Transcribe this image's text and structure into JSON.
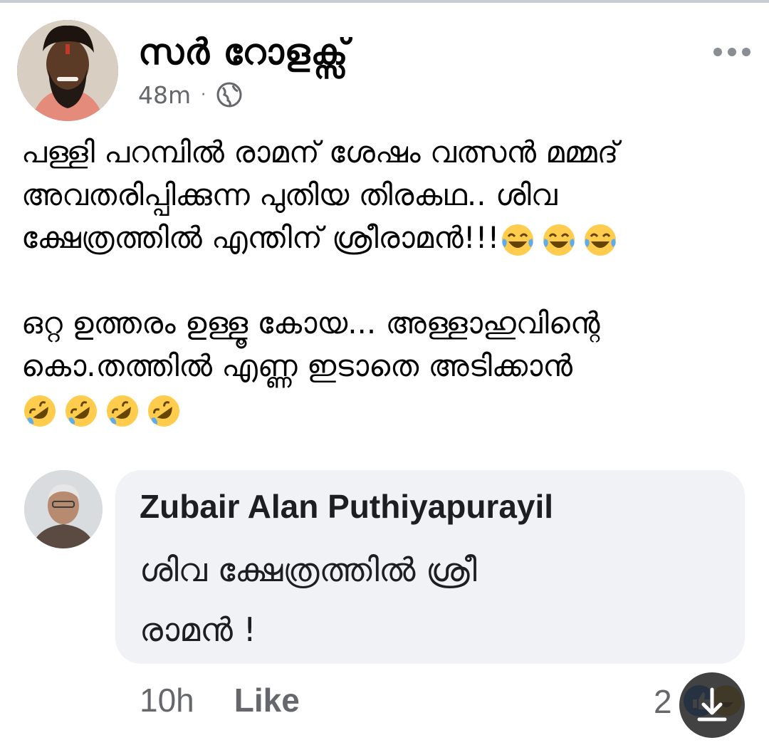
{
  "post": {
    "author": "സർ റോളക്സ്",
    "time": "48m",
    "separator": "·",
    "privacy_icon": "globe-icon",
    "more_icon": "more-options-icon",
    "lines": [
      "പള്ളി പറമ്പിൽ രാമന് ശേഷം വത്സൻ മമ്മദ്",
      "അവതരിപ്പിക്കുന്ന പുതിയ തിരകഥ..  ശിവ",
      "ക്ഷേത്രത്തിൽ എന്തിന് ശ്രീരാമൻ!!!"
    ],
    "lines2": [
      "ഒറ്റ ഉത്തരം ഉള്ളൂ കോയ... അള്ളാഹുവിന്റെ",
      "കൊ.തത്തിൽ എണ്ണ ഇടാതെ അടിക്കാൻ"
    ],
    "emoji_laugh": "face-with-tears-of-joy",
    "emoji_rofl": "rolling-on-floor-laughing"
  },
  "comment": {
    "author": "Zubair Alan Puthiyapurayil",
    "text_line1": "ശിവ ക്ഷേത്രത്തിൽ ശ്രീ",
    "text_line2": "രാമൻ !",
    "time": "10h",
    "like_label": "Like",
    "reaction_count": "2"
  },
  "overlay": {
    "download_icon": "download-icon"
  },
  "colors": {
    "secondary_text": "#65676b",
    "bubble_bg": "#f0f2f5",
    "like_blue": "#1877f2"
  }
}
